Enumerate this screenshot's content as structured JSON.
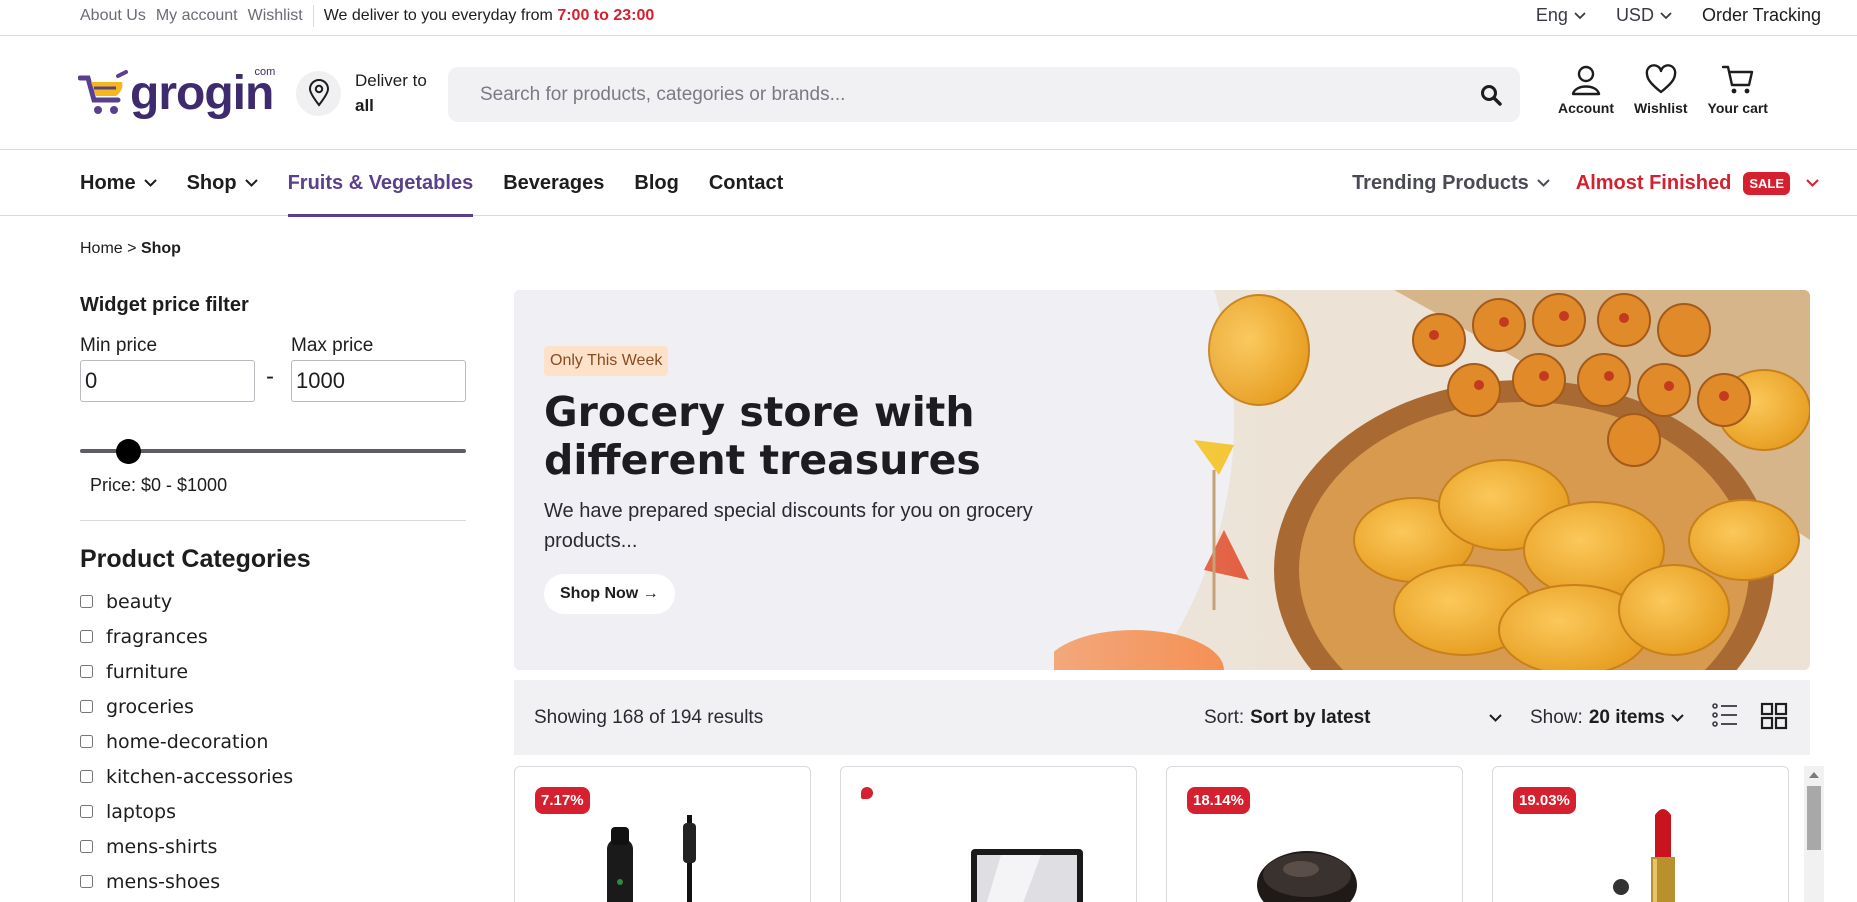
{
  "topbar": {
    "links": [
      "About Us",
      "My account",
      "Wishlist"
    ],
    "deliver_text": "We deliver to you everyday from",
    "deliver_hours": "7:00 to 23:00",
    "language": "Eng",
    "currency": "USD",
    "order_tracking": "Order Tracking"
  },
  "header": {
    "logo_text": "grogin",
    "logo_com": "com",
    "deliver_label": "Deliver to",
    "deliver_value": "all",
    "search_placeholder": "Search for products, categories or brands...",
    "account_label": "Account",
    "wishlist_label": "Wishlist",
    "cart_label": "Your cart"
  },
  "nav": {
    "items": [
      "Home",
      "Shop",
      "Fruits & Vegetables",
      "Beverages",
      "Blog",
      "Contact"
    ],
    "active_index": 2,
    "trending": "Trending Products",
    "almost_finished": "Almost Finished",
    "sale_badge": "SALE"
  },
  "breadcrumb": {
    "home": "Home",
    "separator": ">",
    "current": "Shop"
  },
  "sidebar": {
    "widget_title": "Widget price filter",
    "min_label": "Min price",
    "max_label": "Max price",
    "min_value": "0",
    "max_value": "1000",
    "dash": "-",
    "price_text": "Price: $0 - $1000",
    "categories_title": "Product Categories",
    "categories": [
      "beauty",
      "fragrances",
      "furniture",
      "groceries",
      "home-decoration",
      "kitchen-accessories",
      "laptops",
      "mens-shirts",
      "mens-shoes"
    ]
  },
  "banner": {
    "badge": "Only This Week",
    "title": "Grocery store with different treasures",
    "text": "We have prepared special discounts for you on grocery products...",
    "button": "Shop Now →"
  },
  "results": {
    "count_text": "Showing 168 of 194 results",
    "sort_label": "Sort:",
    "sort_value": "Sort by latest",
    "show_label": "Show:",
    "show_value": "20 items"
  },
  "products": [
    {
      "discount": "7.17%",
      "icon": "mascara"
    },
    {
      "discount": "",
      "icon": "mirror"
    },
    {
      "discount": "18.14%",
      "icon": "powder-compact"
    },
    {
      "discount": "19.03%",
      "icon": "lipstick"
    }
  ],
  "colors": {
    "brand": "#3e2a6e",
    "accent_red": "#d6202f",
    "nav_active": "#5a3f8c"
  }
}
